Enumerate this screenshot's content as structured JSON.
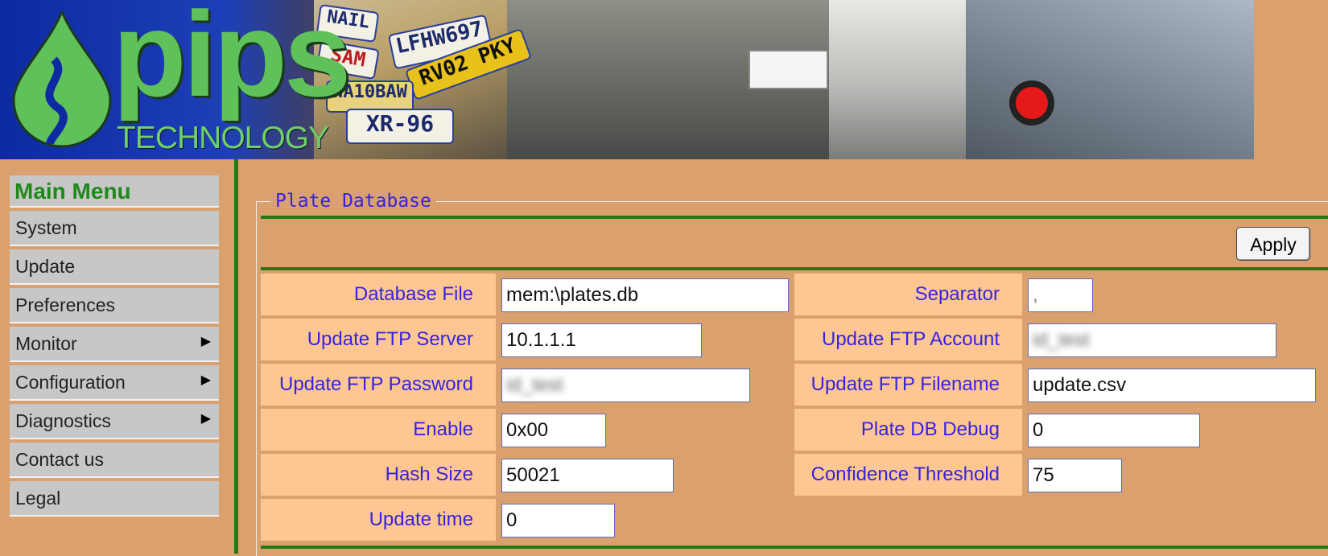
{
  "brand": {
    "logo_text": "pips",
    "logo_sub": "TECHNOLOGY"
  },
  "banner_plates": [
    "NAIL",
    "LFHW697",
    "RV02 PKY",
    "SAM",
    "WA10BAW",
    "XR-96"
  ],
  "sidebar": {
    "title": "Main Menu",
    "items": [
      {
        "label": "System",
        "arrow": ""
      },
      {
        "label": "Update",
        "arrow": ""
      },
      {
        "label": "Preferences",
        "arrow": ""
      },
      {
        "label": "Monitor",
        "arrow": "▶"
      },
      {
        "label": "Configuration",
        "arrow": "▶"
      },
      {
        "label": "Diagnostics",
        "arrow": "▶"
      },
      {
        "label": "Contact us",
        "arrow": ""
      },
      {
        "label": "Legal",
        "arrow": ""
      }
    ]
  },
  "panel": {
    "legend": "Plate Database",
    "apply_label": "Apply",
    "fields": {
      "database_file": {
        "label": "Database File",
        "value": "mem:\\plates.db"
      },
      "separator": {
        "label": "Separator",
        "value": ","
      },
      "update_ftp_server": {
        "label": "Update FTP Server",
        "value": "10.1.1.1"
      },
      "update_ftp_account": {
        "label": "Update FTP Account",
        "value": "id_test"
      },
      "update_ftp_password": {
        "label": "Update FTP Password",
        "value": "id_test"
      },
      "update_ftp_filename": {
        "label": "Update FTP Filename",
        "value": "update.csv"
      },
      "enable": {
        "label": "Enable",
        "value": "0x00"
      },
      "plate_db_debug": {
        "label": "Plate DB Debug",
        "value": "0"
      },
      "hash_size": {
        "label": "Hash Size",
        "value": "50021"
      },
      "confidence_threshold": {
        "label": "Confidence Threshold",
        "value": "75"
      },
      "update_time": {
        "label": "Update time",
        "value": "0"
      }
    }
  },
  "colors": {
    "page_bg": "#daa06d",
    "label_bg": "#fec692",
    "label_text": "#3523e0",
    "accent_green": "#1e7a14",
    "menu_bg": "#c7c7c7",
    "menu_title": "#1f8a1b"
  }
}
